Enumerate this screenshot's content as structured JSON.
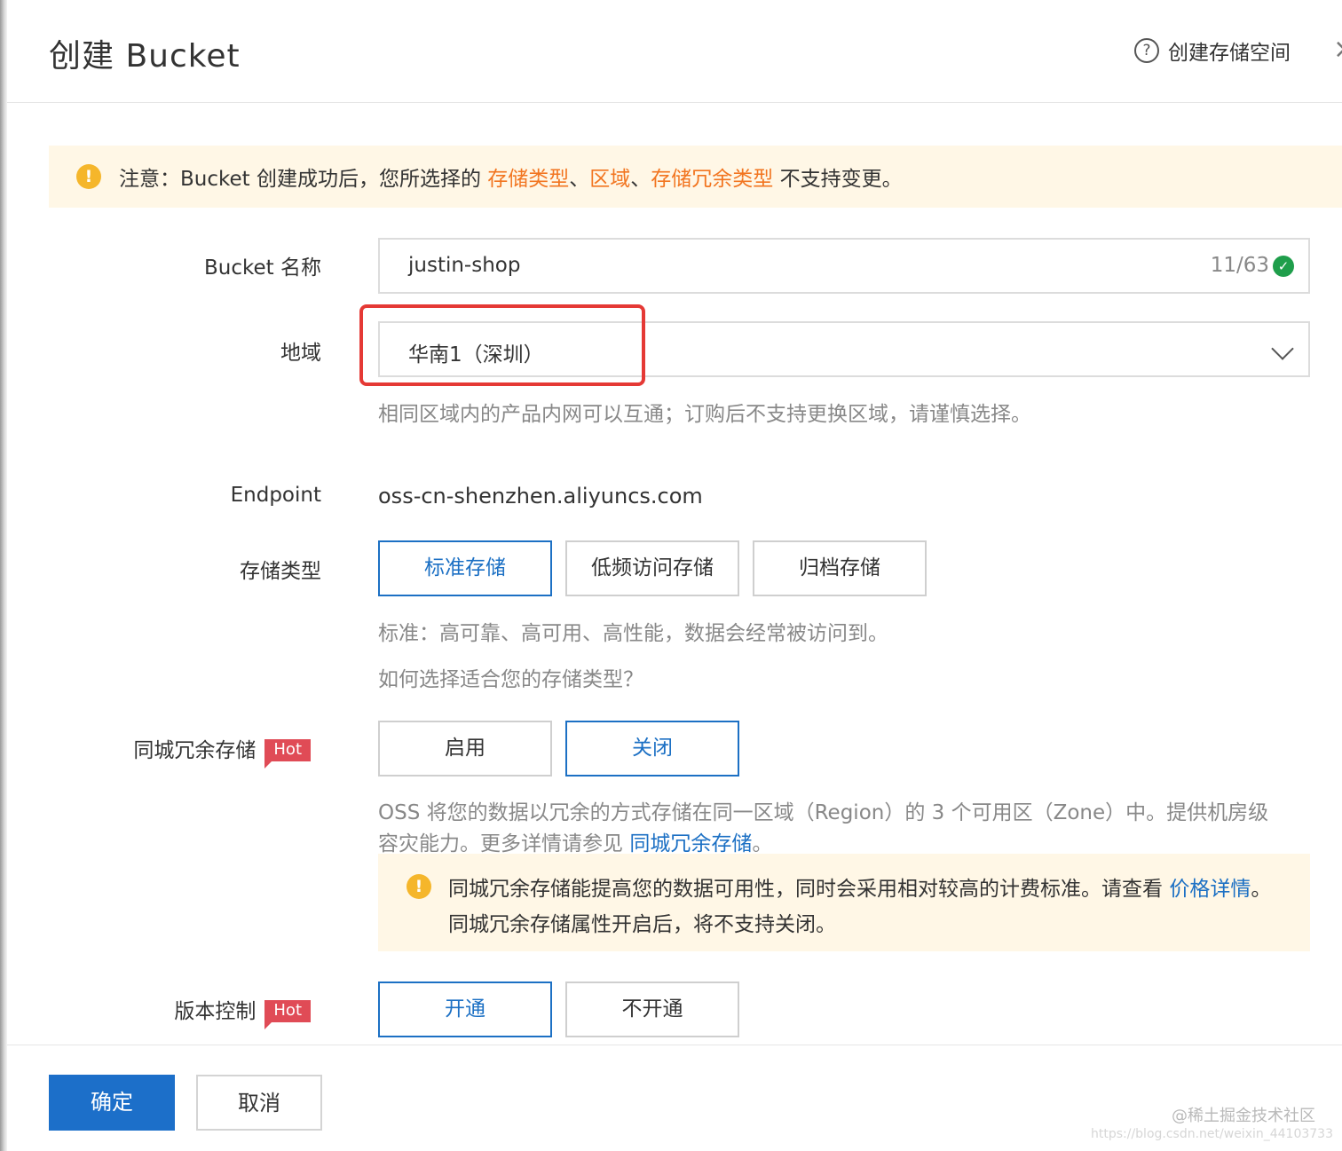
{
  "header": {
    "title": "创建 Bucket",
    "help_icon": "?",
    "help_label": "创建存储空间"
  },
  "notice": {
    "icon": "!",
    "prefix": "注意：Bucket 创建成功后，您所选择的 ",
    "link1": "存储类型",
    "sep1": "、",
    "link2": "区域",
    "sep2": "、",
    "link3": "存储冗余类型",
    "suffix": " 不支持变更。"
  },
  "bucket_name": {
    "label": "Bucket 名称",
    "value": "justin-shop",
    "counter": "11/63"
  },
  "region": {
    "label": "地域",
    "value": "华南1（深圳）",
    "hint": "相同区域内的产品内网可以互通；订购后不支持更换区域，请谨慎选择。"
  },
  "endpoint": {
    "label": "Endpoint",
    "value": "oss-cn-shenzhen.aliyuncs.com"
  },
  "storage_type": {
    "label": "存储类型",
    "options": [
      "标准存储",
      "低频访问存储",
      "归档存储"
    ],
    "selected": "标准存储",
    "hint": "标准：高可靠、高可用、高性能，数据会经常被访问到。",
    "help_link": "如何选择适合您的存储类型？"
  },
  "redundancy": {
    "label": "同城冗余存储",
    "badge": "Hot",
    "options": [
      "启用",
      "关闭"
    ],
    "selected": "关闭",
    "desc_line1": "OSS 将您的数据以冗余的方式存储在同一区域（Region）的 3 个可用区（Zone）中。提供机房级",
    "desc_line2_prefix": "容灾能力。更多详情请参见 ",
    "desc_link": "同城冗余存储",
    "desc_end": "。",
    "notice_icon": "!",
    "notice_text1": "同城冗余存储能提高您的数据可用性，同时会采用相对较高的计费标准。请查看 ",
    "notice_link": "价格详情",
    "notice_text2": "。同城冗余存储属性开启后，将不支持关闭。"
  },
  "versioning": {
    "label": "版本控制",
    "badge": "Hot",
    "options": [
      "开通",
      "不开通"
    ],
    "selected": "开通"
  },
  "footer": {
    "confirm": "确定",
    "cancel": "取消",
    "watermark": "@稀土掘金技术社区",
    "watermark_url": "https://blog.csdn.net/weixin_44103733"
  },
  "colors": {
    "accent": "#1c70c4",
    "warning": "#f27520",
    "highlight": "#e53935",
    "hot": "#e04b56"
  }
}
